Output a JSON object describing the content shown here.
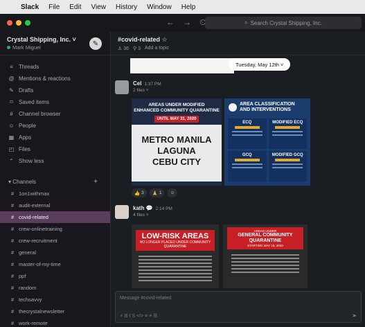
{
  "menubar": {
    "apple_glyph": "",
    "items": [
      "Slack",
      "File",
      "Edit",
      "View",
      "History",
      "Window",
      "Help"
    ]
  },
  "window": {
    "dot_colors": [
      "#ff5f57",
      "#febc2e",
      "#28c840"
    ],
    "nav": {
      "back": "←",
      "forward": "→",
      "history": "⏲"
    },
    "search_placeholder": "Search Crystal Shipping, Inc."
  },
  "workspace": {
    "name": "Crystal Shipping, Inc. ˅",
    "user": "Mark Miguel",
    "compose_glyph": "✎"
  },
  "nav_items": [
    {
      "icon": "threads-icon",
      "glyph": "≡",
      "label": "Threads"
    },
    {
      "icon": "mentions-icon",
      "glyph": "@",
      "label": "Mentions & reactions"
    },
    {
      "icon": "drafts-icon",
      "glyph": "✎",
      "label": "Drafts"
    },
    {
      "icon": "saved-icon",
      "glyph": "⌑",
      "label": "Saved items"
    },
    {
      "icon": "channel-browser-icon",
      "glyph": "#",
      "label": "Channel browser"
    },
    {
      "icon": "people-icon",
      "glyph": "☺",
      "label": "People"
    },
    {
      "icon": "apps-icon",
      "glyph": "▦",
      "label": "Apps"
    },
    {
      "icon": "files-icon",
      "glyph": "◰",
      "label": "Files"
    },
    {
      "icon": "show-less-icon",
      "glyph": "⌃",
      "label": "Show less"
    }
  ],
  "channels": {
    "header": "Channels",
    "add_glyph": "+",
    "items": [
      {
        "label": "1on1withmax",
        "active": false
      },
      {
        "label": "audit-external",
        "active": false
      },
      {
        "label": "covid-related",
        "active": true
      },
      {
        "label": "crew-onlinetraining",
        "active": false
      },
      {
        "label": "crew-recruitment",
        "active": false
      },
      {
        "label": "general",
        "active": false
      },
      {
        "label": "master-of-my-time",
        "active": false
      },
      {
        "label": "ppf",
        "active": false
      },
      {
        "label": "random",
        "active": false
      },
      {
        "label": "techsavvy",
        "active": false
      },
      {
        "label": "thecrystalnewsletter",
        "active": false
      },
      {
        "label": "work-remote",
        "active": false
      },
      {
        "label": "innovator",
        "active": false
      }
    ]
  },
  "channel_header": {
    "name": "#covid-related ☆",
    "members": "♙ 36",
    "pins": "⚲ 3",
    "topic": "Add a topic"
  },
  "date_pill": "Tuesday, May 12th ˅",
  "messages": [
    {
      "author": "Cel",
      "time": "1:37 PM",
      "files": "2 files ˅",
      "avatar_color": "#9a9a9a"
    },
    {
      "author": "kath 💬",
      "time": "2:14 PM",
      "files": "4 files ˅",
      "avatar_color": "#d8d0cc"
    }
  ],
  "images": {
    "ecq": {
      "banner_line1": "AREAS UNDER MODIFIED",
      "banner_line2": "ENHANCED COMMUNITY QUARANTINE",
      "banner_date": "UNTIL MAY 31, 2020",
      "cities": [
        "METRO MANILA",
        "LAGUNA",
        "CEBU CITY"
      ]
    },
    "classification": {
      "title_line1": "AREA CLASSIFICATION",
      "title_line2": "AND INTERVENTIONS",
      "cells": [
        "ECQ",
        "MODIFIED ECQ",
        "GCQ",
        "MODIFIED GCQ"
      ]
    },
    "low_risk": {
      "title": "LOW-RISK AREAS",
      "sub": "NO LONGER PLACED UNDER COMMUNITY QUARANTINE"
    },
    "gcq": {
      "sub": "AREAS UNDER",
      "title_line1": "GENERAL COMMUNITY",
      "title_line2": "QUARANTINE",
      "date": "STARTING MAY 16, 2020"
    }
  },
  "reactions": [
    {
      "emoji": "👍",
      "count": "3"
    },
    {
      "emoji": "🙏",
      "count": "1"
    },
    {
      "emoji": "☺",
      "count": ""
    }
  ],
  "composer": {
    "placeholder": "Message #covid-related",
    "tools": "⚡  B  I  S  </>  ≡  ≡  ☰",
    "send": "➤"
  }
}
